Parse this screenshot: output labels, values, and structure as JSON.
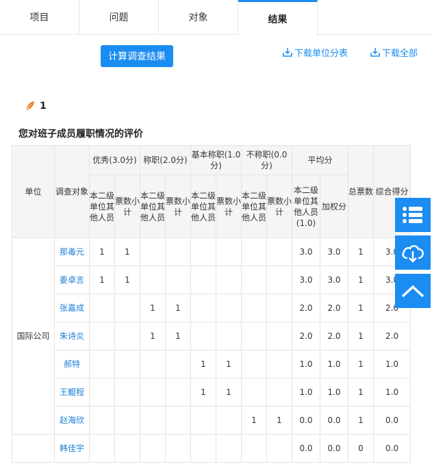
{
  "tabs": [
    {
      "label": "项目",
      "active": false
    },
    {
      "label": "问题",
      "active": false
    },
    {
      "label": "对象",
      "active": false
    },
    {
      "label": "结果",
      "active": true
    }
  ],
  "actions": {
    "calc_label": "计算调查结果",
    "download_unit_label": "下载单位分表",
    "download_all_label": "下载全部"
  },
  "question": {
    "number": "1",
    "title": "您对班子成员履职情况的评价"
  },
  "table": {
    "headers": {
      "unit": "单位",
      "target": "调查对象",
      "excellent": "优秀(3.0分)",
      "competent": "称职(2.0分)",
      "basic": "基本称职(1.0分)",
      "incompetent": "不称职(0.0分)",
      "average": "平均分",
      "total_votes": "总票数",
      "score": "综合得分",
      "sub_other": "本二级单位其他人员",
      "sub_count": "票数小计",
      "sub_avg_other": "本二级单位其他人员(1.0)",
      "sub_weighted": "加权分"
    },
    "unit_name": "国际公司",
    "rows": [
      {
        "name": "那毒元",
        "ex_other": "1",
        "ex_count": "1",
        "co_other": "",
        "co_count": "",
        "ba_other": "",
        "ba_count": "",
        "in_other": "",
        "in_count": "",
        "avg_other": "3.0",
        "weighted": "3.0",
        "total": "1",
        "score": "3.0"
      },
      {
        "name": "姜卓言",
        "ex_other": "1",
        "ex_count": "1",
        "co_other": "",
        "co_count": "",
        "ba_other": "",
        "ba_count": "",
        "in_other": "",
        "in_count": "",
        "avg_other": "3.0",
        "weighted": "3.0",
        "total": "1",
        "score": "3.0"
      },
      {
        "name": "张嘉成",
        "ex_other": "",
        "ex_count": "",
        "co_other": "1",
        "co_count": "1",
        "ba_other": "",
        "ba_count": "",
        "in_other": "",
        "in_count": "",
        "avg_other": "2.0",
        "weighted": "2.0",
        "total": "1",
        "score": "2.0"
      },
      {
        "name": "朱诗炎",
        "ex_other": "",
        "ex_count": "",
        "co_other": "1",
        "co_count": "1",
        "ba_other": "",
        "ba_count": "",
        "in_other": "",
        "in_count": "",
        "avg_other": "2.0",
        "weighted": "2.0",
        "total": "1",
        "score": "2.0"
      },
      {
        "name": "郝特",
        "ex_other": "",
        "ex_count": "",
        "co_other": "",
        "co_count": "",
        "ba_other": "1",
        "ba_count": "1",
        "in_other": "",
        "in_count": "",
        "avg_other": "1.0",
        "weighted": "1.0",
        "total": "1",
        "score": "1.0"
      },
      {
        "name": "王鲲程",
        "ex_other": "",
        "ex_count": "",
        "co_other": "",
        "co_count": "",
        "ba_other": "1",
        "ba_count": "1",
        "in_other": "",
        "in_count": "",
        "avg_other": "1.0",
        "weighted": "1.0",
        "total": "1",
        "score": "1.0"
      },
      {
        "name": "赵海欣",
        "ex_other": "",
        "ex_count": "",
        "co_other": "",
        "co_count": "",
        "ba_other": "",
        "ba_count": "",
        "in_other": "1",
        "in_count": "1",
        "avg_other": "0.0",
        "weighted": "0.0",
        "total": "1",
        "score": "0.0"
      },
      {
        "name": "韩佳宇",
        "ex_other": "",
        "ex_count": "",
        "co_other": "",
        "co_count": "",
        "ba_other": "",
        "ba_count": "",
        "in_other": "",
        "in_count": "",
        "avg_other": "0.0",
        "weighted": "0.0",
        "total": "0",
        "score": "0.0"
      }
    ]
  },
  "side_buttons": {
    "list": "list-icon",
    "download": "cloud-download-icon",
    "top": "chevron-up-icon"
  },
  "colors": {
    "accent": "#1b8cf2",
    "link": "#1b7ed6",
    "header_bg": "#f5f5f5",
    "feather": "#f07b1e"
  }
}
